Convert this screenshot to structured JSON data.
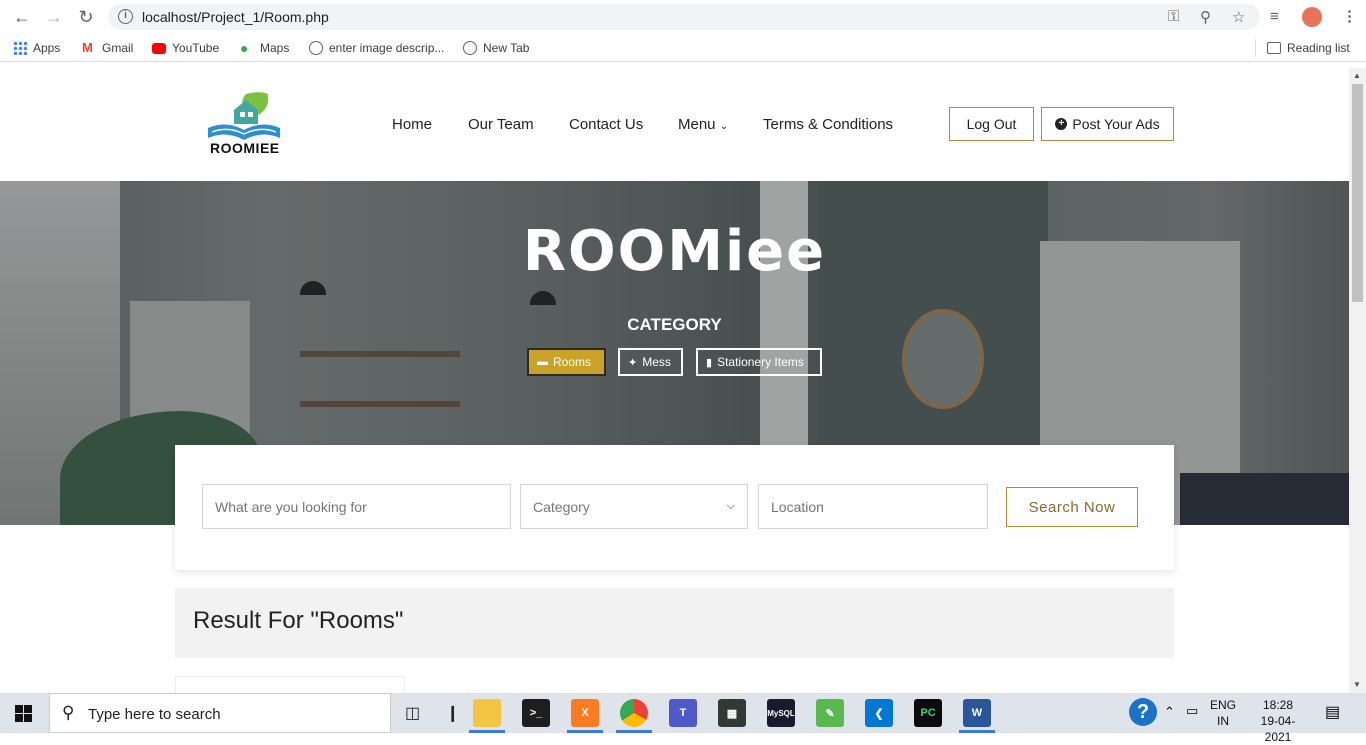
{
  "browser": {
    "url": "localhost/Project_1/Room.php",
    "bookmarks": [
      "Apps",
      "Gmail",
      "YouTube",
      "Maps",
      "enter image descrip...",
      "New Tab"
    ],
    "reading_list": "Reading list"
  },
  "header": {
    "nav": [
      "Home",
      "Our Team",
      "Contact Us",
      "Menu",
      "Terms & Conditions"
    ],
    "logout_label": "Log Out",
    "post_ads_label": "Post Your Ads",
    "logo_text": "ROOMIEE"
  },
  "hero": {
    "title": "ROOMiee",
    "subtitle": "CATEGORY",
    "categories": [
      {
        "label": "Rooms",
        "icon": "bed-icon",
        "active": true
      },
      {
        "label": "Mess",
        "icon": "utensils-icon",
        "active": false
      },
      {
        "label": "Stationery Items",
        "icon": "book-icon",
        "active": false
      }
    ]
  },
  "search": {
    "keyword_placeholder": "What are you looking for",
    "category_selected": "Category",
    "location_placeholder": "Location",
    "button_label": "Search Now"
  },
  "results": {
    "heading": "Result For \"Rooms\""
  },
  "taskbar": {
    "search_placeholder": "Type here to search",
    "lang_top": "ENG",
    "lang_bottom": "IN",
    "time": "18:28",
    "date": "19-04-2021"
  },
  "colors": {
    "accent_gold": "#c9a227",
    "border_gold": "#b58b3a"
  }
}
